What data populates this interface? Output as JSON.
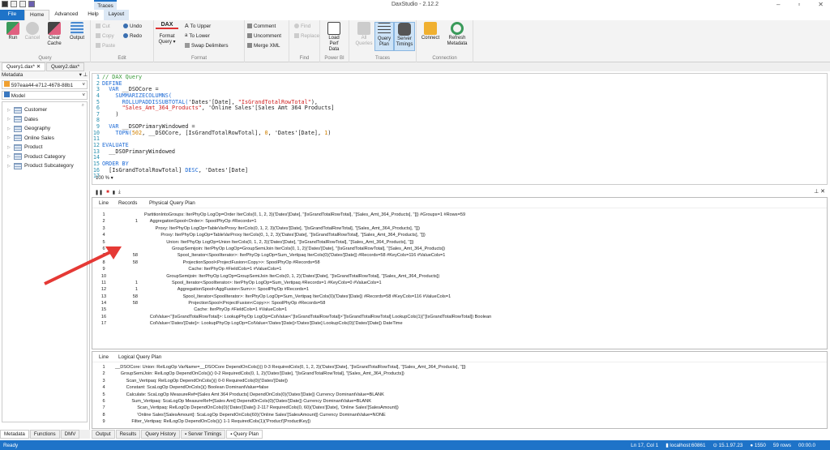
{
  "app": {
    "title": "DaxStudio - 2.12.2"
  },
  "ribbon_tabs": [
    "File",
    "Home",
    "Advanced",
    "Help",
    "Layout"
  ],
  "context_tab": "Traces",
  "ribbon": {
    "query": {
      "label": "Query",
      "run": "Run",
      "cancel": "Cancel",
      "clear_cache": "Clear Cache",
      "output": "Output"
    },
    "edit": {
      "label": "Edit",
      "cut": "Cut",
      "copy": "Copy",
      "paste": "Paste",
      "undo": "Undo",
      "redo": "Redo"
    },
    "format": {
      "label": "Format",
      "format_query": "Format Query",
      "dax_logo": "DAX",
      "to_upper": "To Upper",
      "to_lower": "To Lower",
      "swap_delimiters": "Swap Delimiters",
      "comment": "Comment",
      "uncomment": "Uncomment",
      "merge_xml": "Merge XML"
    },
    "find": {
      "label": "Find",
      "find": "Find",
      "replace": "Replace"
    },
    "powerbi": {
      "label": "Power BI",
      "load_perf_data": "Load Perf Data"
    },
    "traces": {
      "label": "Traces",
      "all_queries": "All Queries",
      "query_plan": "Query Plan",
      "server_timings": "Server Timings"
    },
    "connection": {
      "label": "Connection",
      "connect": "Connect",
      "refresh_metadata": "Refresh Metadata"
    }
  },
  "doc_tabs": [
    {
      "label": "Query1.dax*",
      "close": "✕"
    },
    {
      "label": "Query2.dax*"
    }
  ],
  "metadata": {
    "header": "Metadata",
    "database": "597eaa44-e712-4678-88b1",
    "model": "Model",
    "tables": [
      "Customer",
      "Dates",
      "Geography",
      "Online Sales",
      "Product",
      "Product Category",
      "Product Subcategory"
    ]
  },
  "left_tabs": [
    "Metadata",
    "Functions",
    "DMV"
  ],
  "editor": {
    "zoom": "100 %",
    "lines": [
      [
        [
          "cm",
          "// DAX Query"
        ]
      ],
      [
        [
          "kw",
          "DEFINE"
        ]
      ],
      [
        [
          "",
          "  "
        ],
        [
          "kw",
          "VAR"
        ],
        [
          "",
          " __DSOCore ="
        ]
      ],
      [
        [
          "",
          "    "
        ],
        [
          "fn",
          "SUMMARIZECOLUMNS("
        ]
      ],
      [
        [
          "",
          "      "
        ],
        [
          "fn",
          "ROLLUPADDISSUBTOTAL("
        ],
        [
          "",
          "'Dates'[Date], "
        ],
        [
          "st",
          "\"IsGrandTotalRowTotal\""
        ],
        [
          "",
          "),"
        ]
      ],
      [
        [
          "",
          "      "
        ],
        [
          "st",
          "\"Sales_Amt_364_Products\""
        ],
        [
          "",
          ", 'Online Sales'[Sales Amt 364 Products]"
        ]
      ],
      [
        [
          "",
          "    )"
        ]
      ],
      [
        [
          "",
          ""
        ]
      ],
      [
        [
          "",
          "  "
        ],
        [
          "kw",
          "VAR"
        ],
        [
          "",
          " __DSOPrimaryWindowed ="
        ]
      ],
      [
        [
          "",
          "    "
        ],
        [
          "fn",
          "TOPN("
        ],
        [
          "nm",
          "502"
        ],
        [
          "",
          ", __DSOCore, [IsGrandTotalRowTotal], "
        ],
        [
          "nm",
          "0"
        ],
        [
          "",
          ", 'Dates'[Date], "
        ],
        [
          "nm",
          "1"
        ],
        [
          "",
          ")"
        ]
      ],
      [
        [
          "",
          ""
        ]
      ],
      [
        [
          "kw",
          "EVALUATE"
        ]
      ],
      [
        [
          "",
          "  __DSOPrimaryWindowed"
        ]
      ],
      [
        [
          "",
          ""
        ]
      ],
      [
        [
          "kw",
          "ORDER BY"
        ]
      ],
      [
        [
          "",
          "  [IsGrandTotalRowTotal] "
        ],
        [
          "kw",
          "DESC"
        ],
        [
          "",
          ", 'Dates'[Date]"
        ]
      ],
      [
        [
          "",
          ""
        ]
      ]
    ]
  },
  "physical_plan": {
    "headers": [
      "Line",
      "Records",
      "Physical Query Plan"
    ],
    "rows": [
      {
        "line": "1",
        "records": "",
        "depth": 0,
        "text": "PartitionIntoGroups: IterPhyOp LogOp=Order IterCols(0, 1, 2, 3)('Dates'[Date], ''[IsGrandTotalRowTotal], ''[Sales_Amt_364_Products], ''[]) #Groups=1 #Rows=59"
      },
      {
        "line": "2",
        "records": "1",
        "depth": 1,
        "text": "AggregationSpool<Order>: SpoolPhyOp #Records=1"
      },
      {
        "line": "3",
        "records": "",
        "depth": 2,
        "text": "Proxy: IterPhyOp LogOp=TableVarProxy IterCols(0, 1, 2, 3)('Dates'[Date], ''[IsGrandTotalRowTotal], ''[Sales_Amt_364_Products], ''[])"
      },
      {
        "line": "4",
        "records": "",
        "depth": 3,
        "text": "Proxy: IterPhyOp LogOp=TableVarProxy IterCols(0, 1, 2, 3)('Dates'[Date], ''[IsGrandTotalRowTotal], ''[Sales_Amt_364_Products], ''[])"
      },
      {
        "line": "5",
        "records": "",
        "depth": 4,
        "text": "Union: IterPhyOp LogOp=Union IterCols(0, 1, 2, 3)('Dates'[Date], ''[IsGrandTotalRowTotal], ''[Sales_Amt_364_Products], ''[])"
      },
      {
        "line": "6",
        "records": "",
        "depth": 5,
        "text": "GroupSemijoin: IterPhyOp LogOp=GroupSemiJoin IterCols(0, 1, 2)('Dates'[Date], ''[IsGrandTotalRowTotal], ''[Sales_Amt_364_Products])"
      },
      {
        "line": "7",
        "records": "58",
        "depth": 6,
        "text": "Spool_Iterator<SpoolIterator>: IterPhyOp LogOp=Sum_Vertipaq IterCols(0)('Dates'[Date]) #Records=58 #KeyCols=116 #ValueCols=1"
      },
      {
        "line": "8",
        "records": "58",
        "depth": 7,
        "text": "ProjectionSpool<ProjectFusion<Copy>>: SpoolPhyOp #Records=58"
      },
      {
        "line": "9",
        "records": "",
        "depth": 8,
        "text": "Cache: IterPhyOp #FieldCols=1 #ValueCols=1"
      },
      {
        "line": "10",
        "records": "",
        "depth": 4,
        "text": "GroupSemijoin: IterPhyOp LogOp=GroupSemiJoin IterCols(0, 1, 2)('Dates'[Date], ''[IsGrandTotalRowTotal], ''[Sales_Amt_364_Products])"
      },
      {
        "line": "11",
        "records": "1",
        "depth": 5,
        "text": "Spool_Iterator<SpoolIterator>: IterPhyOp LogOp=Sum_Vertipaq #Records=1 #KeyCols=0 #ValueCols=1"
      },
      {
        "line": "12",
        "records": "1",
        "depth": 6,
        "text": "AggregationSpool<AggFusion<Sum>>: SpoolPhyOp #Records=1"
      },
      {
        "line": "13",
        "records": "58",
        "depth": 7,
        "text": "Spool_Iterator<SpoolIterator>: IterPhyOp LogOp=Sum_Vertipaq IterCols(0)('Dates'[Date]) #Records=58 #KeyCols=116 #ValueCols=1"
      },
      {
        "line": "14",
        "records": "58",
        "depth": 8,
        "text": "ProjectionSpool<ProjectFusion<Copy>>: SpoolPhyOp #Records=58"
      },
      {
        "line": "15",
        "records": "",
        "depth": 9,
        "text": "Cache: IterPhyOp #FieldCols=1 #ValueCols=1"
      },
      {
        "line": "16",
        "records": "",
        "depth": 1,
        "text": "ColValue<''[IsGrandTotalRowTotal]>: LookupPhyOp LogOp=ColValue<''[IsGrandTotalRowTotal]>''[IsGrandTotalRowTotal] LookupCols(1)(''[IsGrandTotalRowTotal]) Boolean"
      },
      {
        "line": "17",
        "records": "",
        "depth": 1,
        "text": "ColValue<'Dates'[Date]>: LookupPhyOp LogOp=ColValue<'Dates'[Date]>'Dates'[Date] LookupCols(0)('Dates'[Date]) DateTime"
      }
    ]
  },
  "logical_plan": {
    "headers": [
      "Line",
      "Logical Query Plan"
    ],
    "rows": [
      {
        "line": "1",
        "depth": 0,
        "text": "__DSOCore: Union: RelLogOp VarName=__DSOCore DependOnCols()() 0-3 RequiredCols(0, 1, 2, 3)('Dates'[Date], ''[IsGrandTotalRowTotal], ''[Sales_Amt_364_Products], ''[])"
      },
      {
        "line": "2",
        "depth": 1,
        "text": "GroupSemiJoin: RelLogOp DependOnCols()() 0-2 RequiredCols(0, 1, 2)('Dates'[Date], ''[IsGrandTotalRowTotal], ''[Sales_Amt_364_Products])"
      },
      {
        "line": "3",
        "depth": 2,
        "text": "Scan_Vertipaq: RelLogOp DependOnCols()() 0-0 RequiredCols(0)('Dates'[Date])"
      },
      {
        "line": "4",
        "depth": 2,
        "text": "Constant: ScaLogOp DependOnCols()() Boolean DominantValue=false"
      },
      {
        "line": "5",
        "depth": 2,
        "text": "Calculate: ScaLogOp MeasureRef=[Sales Amt 364 Products] DependOnCols(0)('Dates'[Date]) Currency DominantValue=BLANK"
      },
      {
        "line": "6",
        "depth": 3,
        "text": "Sum_Vertipaq: ScaLogOp MeasureRef=[Sales Amt] DependOnCols(0)('Dates'[Date]) Currency DominantValue=BLANK"
      },
      {
        "line": "7",
        "depth": 4,
        "text": "Scan_Vertipaq: RelLogOp DependOnCols(0)('Dates'[Date]) 2-117 RequiredCols(0, 60)('Dates'[Date], 'Online Sales'[SalesAmount])"
      },
      {
        "line": "8",
        "depth": 4,
        "text": "'Online Sales'[SalesAmount]: ScaLogOp DependOnCols(60)('Online Sales'[SalesAmount]) Currency DominantValue=NONE"
      },
      {
        "line": "9",
        "depth": 3,
        "text": "Filter_Vertipaq: RelLogOp DependOnCols()() 1-1 RequiredCols(1)('Product'[ProductKey])"
      }
    ]
  },
  "bottom_tabs": [
    "Output",
    "Results",
    "Query History",
    "Server Timings",
    "Query Plan"
  ],
  "status": {
    "left": "Ready",
    "position": "Ln 17, Col 1",
    "server": "localhost:60861",
    "version": "15.1.97.23",
    "spid": "1550",
    "rows": "59 rows",
    "duration": "00:00.0"
  },
  "colors": {
    "accent": "#1e73c8",
    "arrow": "#e53935"
  }
}
